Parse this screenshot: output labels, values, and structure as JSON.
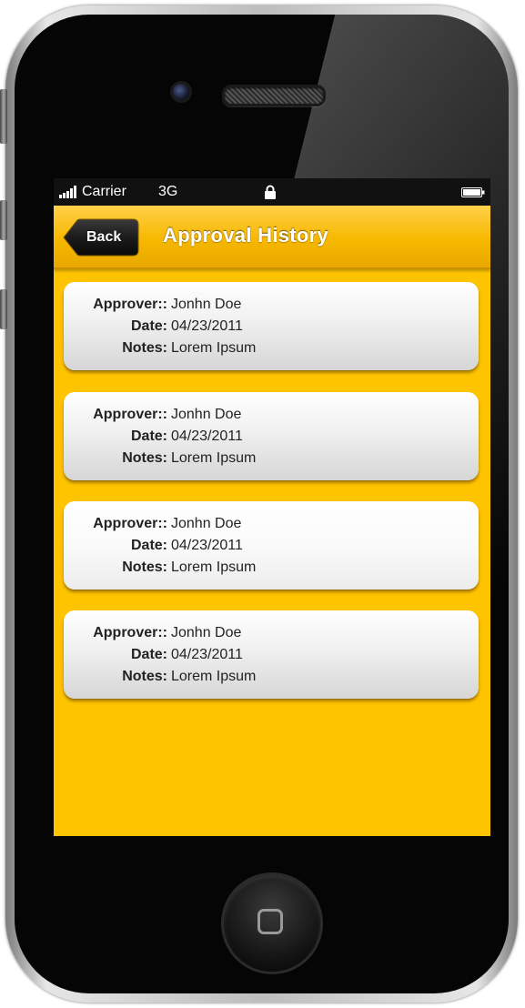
{
  "status_bar": {
    "carrier": "Carrier",
    "network": "3G",
    "signal_icon": "signal-bars-icon",
    "lock_icon": "lock-icon",
    "battery_icon": "battery-icon"
  },
  "nav_bar": {
    "back_label": "Back",
    "title": "Approval History"
  },
  "approvals": [
    {
      "approver_label": "Approver::",
      "approver": "Jonhn Doe",
      "date_label": "Date:",
      "date": "04/23/2011",
      "notes_label": "Notes:",
      "notes": "Lorem Ipsum"
    },
    {
      "approver_label": "Approver::",
      "approver": "Jonhn Doe",
      "date_label": "Date:",
      "date": "04/23/2011",
      "notes_label": "Notes:",
      "notes": "Lorem Ipsum"
    },
    {
      "approver_label": "Approver::",
      "approver": "Jonhn Doe",
      "date_label": "Date:",
      "date": "04/23/2011",
      "notes_label": "Notes:",
      "notes": "Lorem Ipsum"
    },
    {
      "approver_label": "Approver::",
      "approver": "Jonhn Doe",
      "date_label": "Date:",
      "date": "04/23/2011",
      "notes_label": "Notes:",
      "notes": "Lorem Ipsum"
    }
  ],
  "colors": {
    "accent": "#ffc400",
    "nav_top": "#ffd04a",
    "nav_bottom": "#e8a800",
    "back_button": "#1a1a1a"
  }
}
